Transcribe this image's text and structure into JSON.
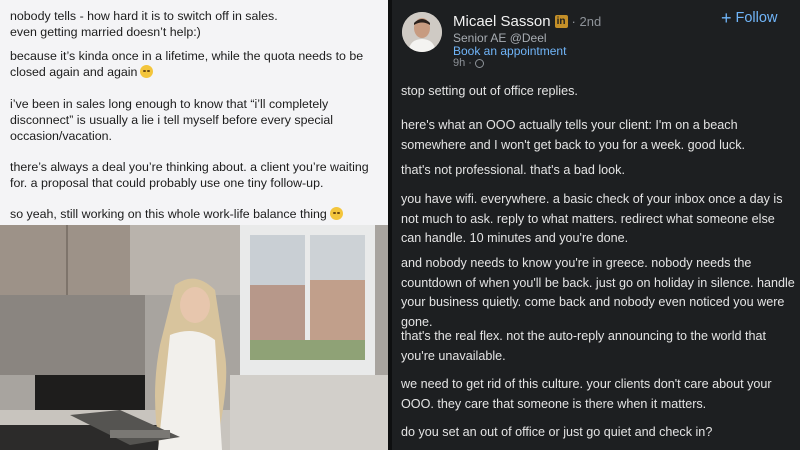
{
  "left_post": {
    "paragraphs": [
      "nobody tells - how hard it is to switch off in sales.\neven getting married doesn’t help:)",
      "because it’s kinda once in a lifetime, while the quota needs to be closed again and again",
      "i’ve been in sales long enough to know that “i’ll completely disconnect” is usually a lie i tell myself before every special occasion/vacation.",
      "there’s always a deal you’re thinking about. a client you’re waiting for. a proposal that could probably use one tiny follow-up.",
      "so yeah, still working on this whole work-life balance thing"
    ]
  },
  "right_post": {
    "author": {
      "name": "Micael Sasson",
      "badge": "in",
      "degree": "· 2nd",
      "headline": "Senior AE @Deel",
      "link": "Book an appointment",
      "time": "9h ·"
    },
    "follow_label": "Follow",
    "paragraphs": [
      "stop setting out of office replies.",
      "here's what an OOO actually tells your client: I'm on a beach somewhere and I won't get back to you for a week. good luck.",
      "that's not professional. that's a bad look.",
      "you have wifi. everywhere. a basic check of your inbox once a day is not much to ask. reply to what matters. redirect what someone else can handle. 10 minutes and you're done.",
      "and nobody needs to know you're in greece. nobody needs the countdown of when you'll be back. just go on holiday in silence. handle your business quietly. come back and nobody even noticed you were gone.",
      "that's the real flex. not the auto-reply announcing to the world that you're unavailable.",
      "we need to get rid of this culture. your clients don't care about your OOO. they care that someone is there when it matters.",
      "do you set an out of office or just go quiet and check in?"
    ]
  },
  "colors": {
    "accent": "#70b5f9",
    "dark_bg": "#1d1f21",
    "light_bg": "#f4f4f6"
  }
}
